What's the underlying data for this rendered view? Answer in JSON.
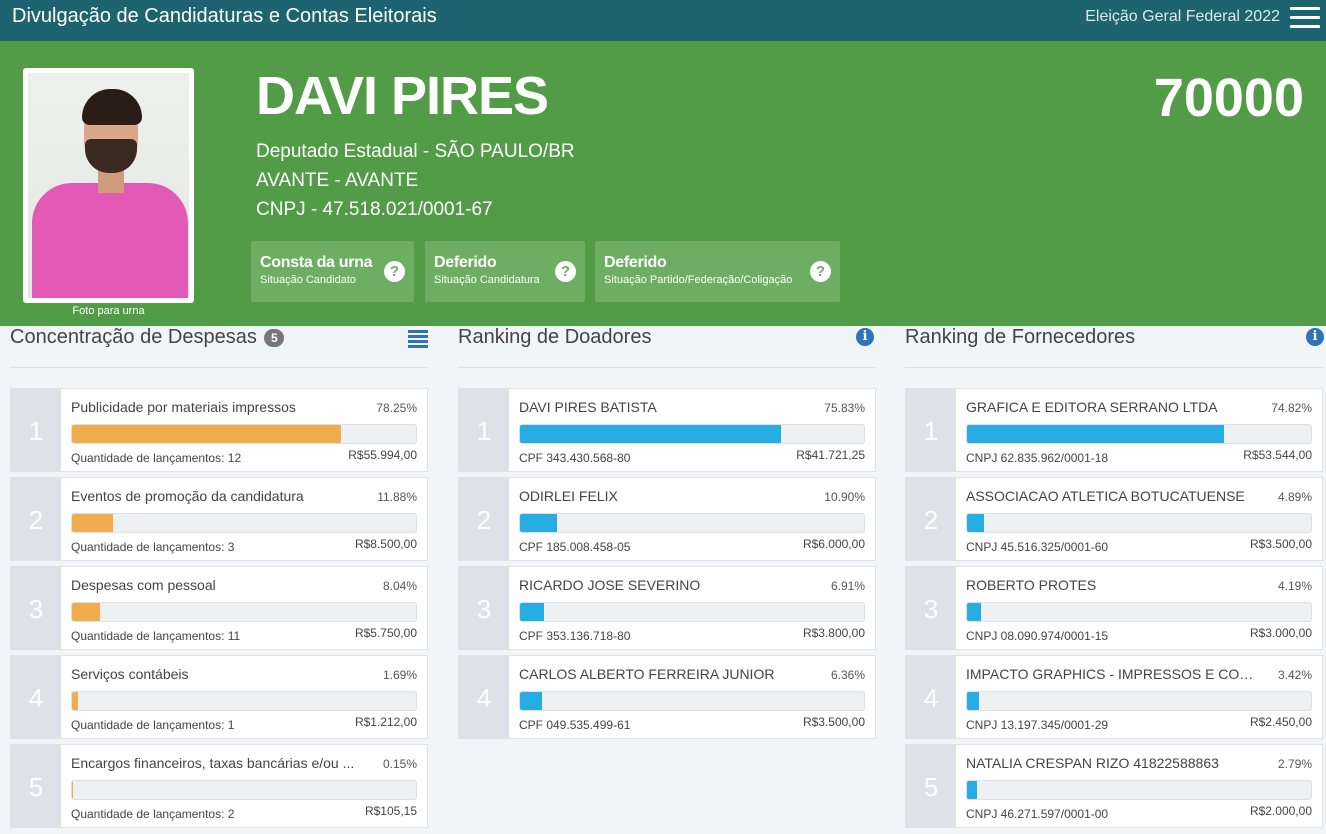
{
  "header": {
    "title": "Divulgação de Candidaturas e Contas Eleitorais",
    "election": "Eleição Geral Federal 2022"
  },
  "candidate": {
    "name": "DAVI PIRES",
    "number": "70000",
    "office": "Deputado Estadual - SÃO PAULO/BR",
    "party": "AVANTE - AVANTE",
    "cnpj": "CNPJ - 47.518.021/0001-67",
    "photo_caption": "Foto para urna",
    "statuses": [
      {
        "title": "Consta da urna",
        "subtitle": "Situação Candidato"
      },
      {
        "title": "Deferido",
        "subtitle": "Situação Candidatura"
      },
      {
        "title": "Deferido",
        "subtitle": "Situação Partido/Federação/Coligação"
      }
    ]
  },
  "colors": {
    "header": "#1d6470",
    "hero": "#529b47",
    "expense_bar": "#f0ad4e",
    "ranking_bar": "#26ade4"
  },
  "expenses": {
    "title": "Concentração de Despesas",
    "count": "5",
    "items": [
      {
        "rank": "1",
        "name": "Publicidade por materiais impressos",
        "pct": "78.25%",
        "fill": 78.25,
        "sub": "Quantidade de lançamentos: 12",
        "value": "R$55.994,00"
      },
      {
        "rank": "2",
        "name": "Eventos de promoção da candidatura",
        "pct": "11.88%",
        "fill": 11.88,
        "sub": "Quantidade de lançamentos: 3",
        "value": "R$8.500,00"
      },
      {
        "rank": "3",
        "name": "Despesas com pessoal",
        "pct": "8.04%",
        "fill": 8.04,
        "sub": "Quantidade de lançamentos: 11",
        "value": "R$5.750,00"
      },
      {
        "rank": "4",
        "name": "Serviços contábeis",
        "pct": "1.69%",
        "fill": 1.69,
        "sub": "Quantidade de lançamentos: 1",
        "value": "R$1.212,00"
      },
      {
        "rank": "5",
        "name": "Encargos financeiros, taxas bancárias e/ou ...",
        "pct": "0.15%",
        "fill": 0.15,
        "sub": "Quantidade de lançamentos: 2",
        "value": "R$105,15"
      }
    ]
  },
  "donors": {
    "title": "Ranking de Doadores",
    "items": [
      {
        "rank": "1",
        "name": "DAVI PIRES BATISTA",
        "pct": "75.83%",
        "fill": 75.83,
        "sub": "CPF 343.430.568-80",
        "value": "R$41.721,25"
      },
      {
        "rank": "2",
        "name": "ODIRLEI FELIX",
        "pct": "10.90%",
        "fill": 10.9,
        "sub": "CPF 185.008.458-05",
        "value": "R$6.000,00"
      },
      {
        "rank": "3",
        "name": "RICARDO JOSE SEVERINO",
        "pct": "6.91%",
        "fill": 6.91,
        "sub": "CPF 353.136.718-80",
        "value": "R$3.800,00"
      },
      {
        "rank": "4",
        "name": "CARLOS ALBERTO FERREIRA JUNIOR",
        "pct": "6.36%",
        "fill": 6.36,
        "sub": "CPF 049.535.499-61",
        "value": "R$3.500,00"
      }
    ]
  },
  "suppliers": {
    "title": "Ranking de Fornecedores",
    "items": [
      {
        "rank": "1",
        "name": "GRAFICA E EDITORA SERRANO LTDA",
        "pct": "74.82%",
        "fill": 74.82,
        "sub": "CNPJ 62.835.962/0001-18",
        "value": "R$53.544,00"
      },
      {
        "rank": "2",
        "name": "ASSOCIACAO ATLETICA BOTUCATUENSE",
        "pct": "4.89%",
        "fill": 4.89,
        "sub": "CNPJ 45.516.325/0001-60",
        "value": "R$3.500,00"
      },
      {
        "rank": "3",
        "name": "ROBERTO PROTES",
        "pct": "4.19%",
        "fill": 4.19,
        "sub": "CNPJ 08.090.974/0001-15",
        "value": "R$3.000,00"
      },
      {
        "rank": "4",
        "name": "IMPACTO GRAPHICS - IMPRESSOS E COMU...",
        "pct": "3.42%",
        "fill": 3.42,
        "sub": "CNPJ 13.197.345/0001-29",
        "value": "R$2.450,00"
      },
      {
        "rank": "5",
        "name": "NATALIA CRESPAN RIZO 41822588863",
        "pct": "2.79%",
        "fill": 2.79,
        "sub": "CNPJ 46.271.597/0001-00",
        "value": "R$2.000,00"
      }
    ]
  }
}
